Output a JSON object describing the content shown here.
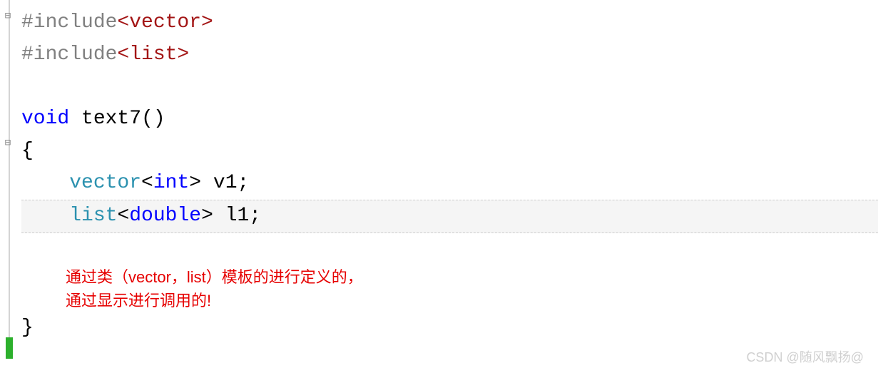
{
  "code": {
    "line1": {
      "prefix": "#include",
      "header": "<vector>"
    },
    "line2": {
      "prefix": "#include",
      "header": "<list>"
    },
    "line4": {
      "keyword": "void",
      "funcname": " text7()"
    },
    "line5": "{",
    "line6": {
      "indent": "    ",
      "type1": "vector",
      "angle1": "<",
      "innertype": "int",
      "angle2": ">",
      "rest": " v1;"
    },
    "line7": {
      "indent": "    ",
      "type1": "list",
      "angle1": "<",
      "innertype": "double",
      "angle2": ">",
      "rest": " l1;"
    },
    "line10": "}",
    "comment1": "通过类（vector，list）模板的进行定义的，",
    "comment2": "通过显示进行调用的!"
  },
  "watermark": "CSDN @随风飘扬@",
  "fold_markers": {
    "m1": "⊟",
    "m2": "⊟"
  }
}
